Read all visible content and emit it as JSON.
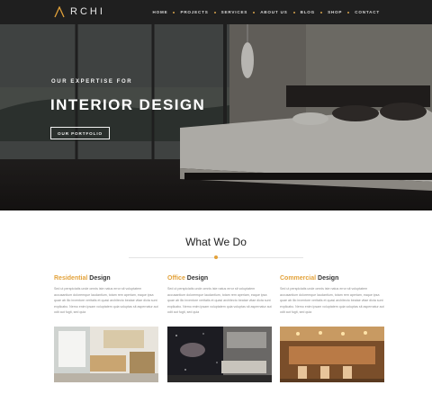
{
  "brand": {
    "name": "RCHI"
  },
  "nav": {
    "items": [
      "HOME",
      "PROJECTS",
      "SERVICES",
      "ABOUT US",
      "BLOG",
      "SHOP",
      "CONTACT"
    ]
  },
  "hero": {
    "eyebrow": "OUR EXPERTISE FOR",
    "title": "INTERIOR DESIGN",
    "button": "OUR PORTFOLIO"
  },
  "section": {
    "title": "What We Do"
  },
  "services": [
    {
      "accent": "Residential",
      "rest": " Design",
      "text": "Sed ut perspiciatis unde omnis iste natus error sit voluptatem accusantium doloremque laudantium, totam rem aperiam, eaque ipsa quae ab illo inventore veritatis et quasi architecto beatae vitae dicta sunt explicabo. Nemo enim ipsam voluptatem quia voluptas sit aspernatur aut odit aut fugit, sed quia"
    },
    {
      "accent": "Office",
      "rest": " Design",
      "text": "Sed ut perspiciatis unde omnis iste natus error sit voluptatem accusantium doloremque laudantium, totam rem aperiam, eaque ipsa quae ab illo inventore veritatis et quasi architecto beatae vitae dicta sunt explicabo. Nemo enim ipsam voluptatem quia voluptas sit aspernatur aut odit aut fugit, sed quia"
    },
    {
      "accent": "Commercial",
      "rest": " Design",
      "text": "Sed ut perspiciatis unde omnis iste natus error sit voluptatem accusantium doloremque laudantium, totam rem aperiam, eaque ipsa quae ab illo inventore veritatis et quasi architecto beatae vitae dicta sunt explicabo. Nemo enim ipsam voluptatem quia voluptas sit aspernatur aut odit aut fugit, sed quia"
    }
  ],
  "colors": {
    "accent": "#e3a23a",
    "navbar": "#1f1f1f"
  }
}
